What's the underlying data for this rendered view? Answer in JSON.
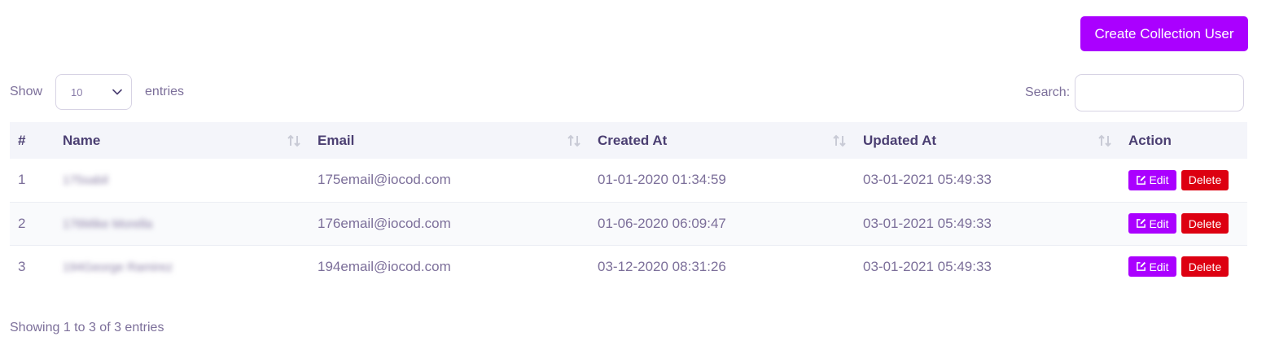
{
  "header": {
    "create_button_label": "Create Collection User"
  },
  "length_control": {
    "show_label": "Show",
    "selected_value": "10",
    "entries_label": "entries"
  },
  "search": {
    "label": "Search:",
    "value": ""
  },
  "table": {
    "columns": [
      "#",
      "Name",
      "Email",
      "Created At",
      "Updated At",
      "Action"
    ],
    "rows": [
      {
        "num": "1",
        "name": "175sabil",
        "email": "175email@iocod.com",
        "created_at": "01-01-2020 01:34:59",
        "updated_at": "03-01-2021 05:49:33"
      },
      {
        "num": "2",
        "name": "176Mike Morella",
        "email": "176email@iocod.com",
        "created_at": "01-06-2020 06:09:47",
        "updated_at": "03-01-2021 05:49:33"
      },
      {
        "num": "3",
        "name": "194George Ramirez",
        "email": "194email@iocod.com",
        "created_at": "03-12-2020 08:31:26",
        "updated_at": "03-01-2021 05:49:33"
      }
    ],
    "action_labels": {
      "edit": "Edit",
      "delete": "Delete"
    }
  },
  "info_text": "Showing 1 to 3 of 3 entries",
  "colors": {
    "accent": "#aa00ff",
    "danger": "#dd0011",
    "header_bg": "#f4f5fa",
    "text": "#7c6f9a",
    "heading_text": "#4b3f72"
  },
  "icons": {
    "sort": "sort-arrows-icon",
    "select_chevron": "chevron-down-icon",
    "edit": "edit-square-icon"
  }
}
